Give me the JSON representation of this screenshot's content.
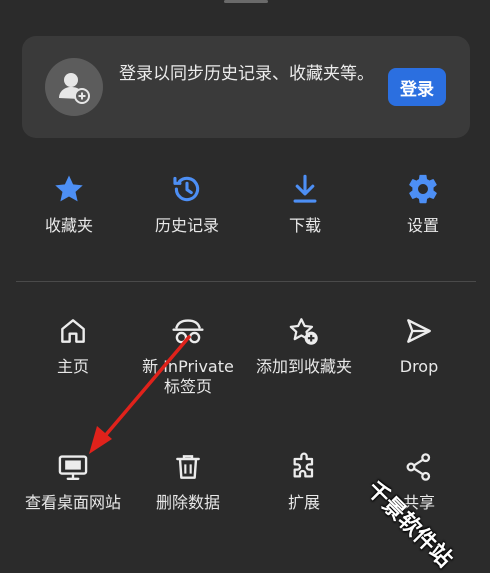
{
  "signin": {
    "message": "登录以同步历史记录、收藏夹等。",
    "button_label": "登录"
  },
  "quick_actions": [
    {
      "label": "收藏夹",
      "icon": "star-icon"
    },
    {
      "label": "历史记录",
      "icon": "history-icon"
    },
    {
      "label": "下载",
      "icon": "download-icon"
    },
    {
      "label": "设置",
      "icon": "gear-icon"
    }
  ],
  "menu_items_row1": [
    {
      "label": "主页",
      "icon": "home-icon"
    },
    {
      "label": "新 InPrivate 标签页",
      "icon": "inprivate-icon"
    },
    {
      "label": "添加到收藏夹",
      "icon": "add-favorite-icon"
    },
    {
      "label": "Drop",
      "icon": "send-icon"
    }
  ],
  "menu_items_row2": [
    {
      "label": "查看桌面网站",
      "icon": "desktop-icon"
    },
    {
      "label": "删除数据",
      "icon": "trash-icon"
    },
    {
      "label": "扩展",
      "icon": "puzzle-icon"
    },
    {
      "label": "共享",
      "icon": "share-icon"
    }
  ],
  "colors": {
    "background": "#2b2b2b",
    "card": "#3a3a3a",
    "accent_blue": "#2b6fe0",
    "quick_icon_blue": "#4d8ff5",
    "annotation_red": "#e0221b"
  },
  "watermark": "千景软件站"
}
